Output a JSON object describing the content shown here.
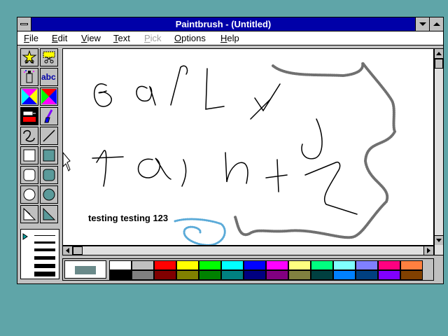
{
  "window": {
    "title": "Paintbrush - (Untitled)"
  },
  "menu": [
    {
      "label": "File",
      "key": "F",
      "rest": "ile",
      "disabled": false
    },
    {
      "label": "Edit",
      "key": "E",
      "rest": "dit",
      "disabled": false
    },
    {
      "label": "View",
      "key": "V",
      "rest": "iew",
      "disabled": false
    },
    {
      "label": "Text",
      "key": "T",
      "rest": "ext",
      "disabled": false
    },
    {
      "label": "Pick",
      "key": "P",
      "rest": "ick",
      "disabled": true
    },
    {
      "label": "Options",
      "key": "O",
      "rest": "ptions",
      "disabled": false
    },
    {
      "label": "Help",
      "key": "H",
      "rest": "elp",
      "disabled": false
    }
  ],
  "canvas": {
    "text": "testing testing 123"
  },
  "colors": {
    "title_bar": "#0000a8",
    "desktop": "#5fa5a8",
    "selected_fg": "#6a8a8a"
  },
  "palette_top": [
    "#ffffff",
    "#c0c0c0",
    "#ff0000",
    "#ffff00",
    "#00ff00",
    "#00ffff",
    "#0000ff",
    "#ff00ff",
    "#ffff80",
    "#00ff80",
    "#80ffff",
    "#8080ff",
    "#ff0080",
    "#ff8040"
  ],
  "palette_bottom": [
    "#000000",
    "#808080",
    "#800000",
    "#808000",
    "#008000",
    "#008080",
    "#000080",
    "#800080",
    "#808040",
    "#004040",
    "#0080ff",
    "#004080",
    "#8000ff",
    "#804000"
  ]
}
